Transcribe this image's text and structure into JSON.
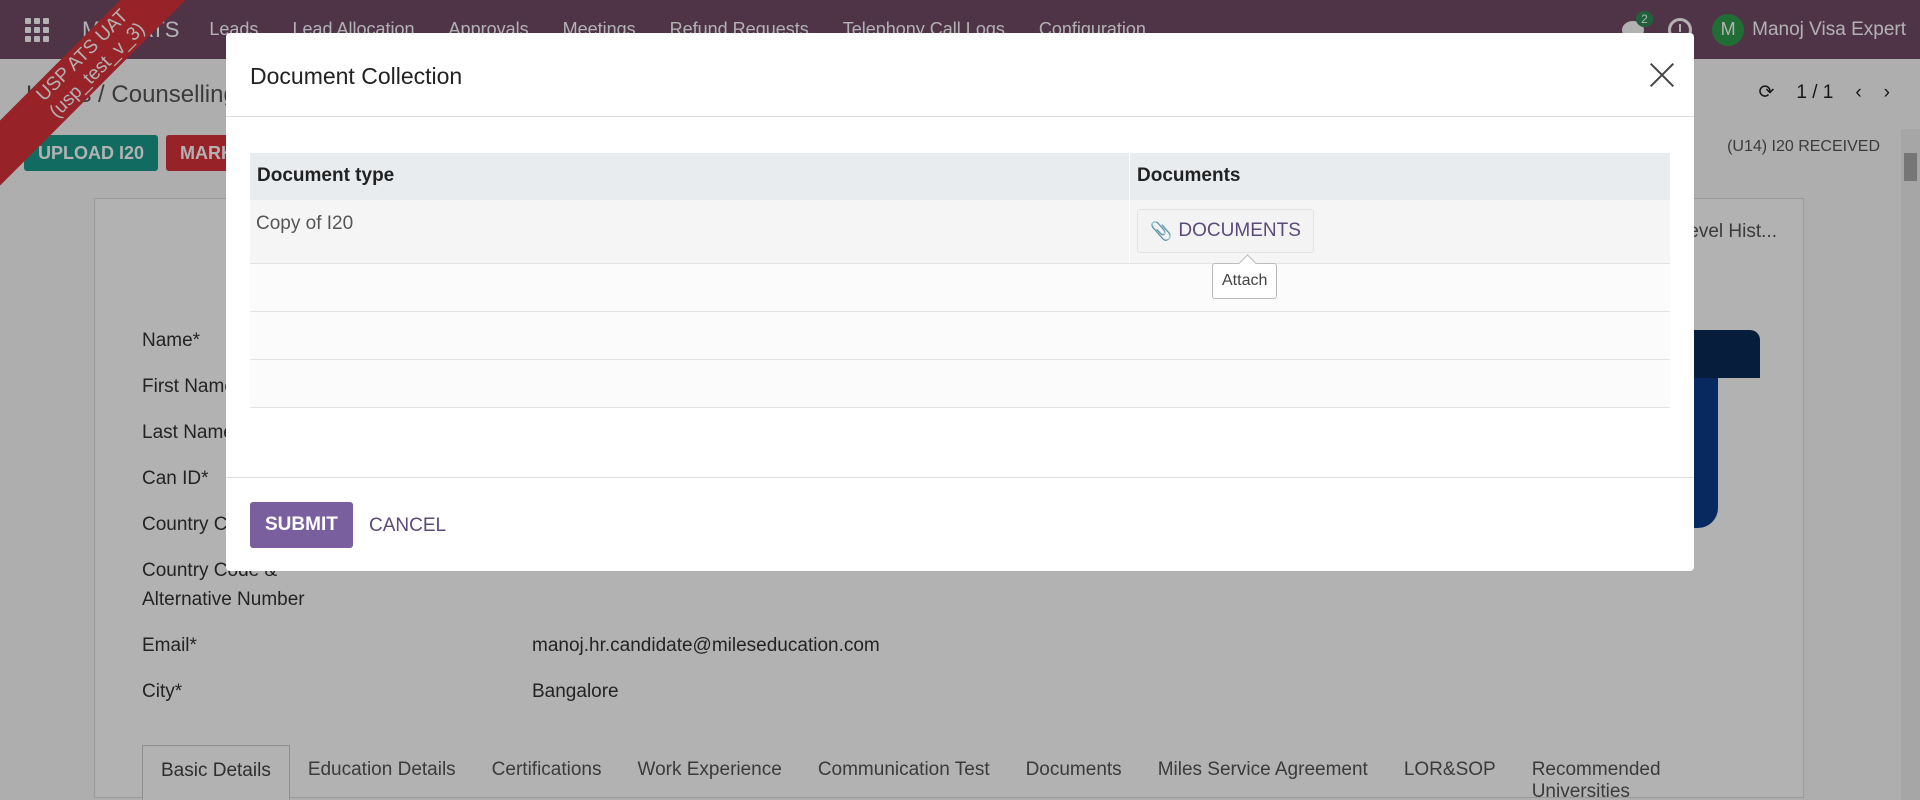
{
  "navbar": {
    "app_name": "Miles ATS",
    "menu": [
      "Leads",
      "Lead Allocation",
      "Approvals",
      "Meetings",
      "Refund Requests",
      "Telephony Call Logs",
      "Configuration"
    ],
    "chat_count": "2",
    "user_initial": "M",
    "user_name": "Manoj Visa Expert"
  },
  "ribbon": {
    "line1": "USP ATS UAT",
    "line2": "(usp_test_v_3)"
  },
  "control": {
    "breadcrumb": "Leads / Counselling",
    "pager": "1 / 1",
    "buttons": [
      "UPLOAD I20",
      "MARK"
    ],
    "status": "(U14) I20 RECEIVED",
    "level_history": "Level Hist..."
  },
  "form": {
    "labels": [
      "Name*",
      "First Name",
      "Last Name",
      "Can ID*",
      "Country C",
      "Country Code &",
      "Alternative Number",
      "Email*",
      "City*"
    ],
    "email": "manoj.hr.candidate@mileseducation.com",
    "city": "Bangalore",
    "tabs": [
      "Basic Details",
      "Education Details",
      "Certifications",
      "Work Experience",
      "Communication Test",
      "Documents",
      "Miles Service Agreement",
      "LOR&SOP",
      "Recommended Universities"
    ]
  },
  "modal": {
    "title": "Document Collection",
    "columns": [
      "Document type",
      "Documents"
    ],
    "rows": [
      {
        "type": "Copy of I20",
        "button": "DOCUMENTS"
      }
    ],
    "tooltip": "Attach",
    "submit": "SUBMIT",
    "cancel": "CANCEL"
  }
}
